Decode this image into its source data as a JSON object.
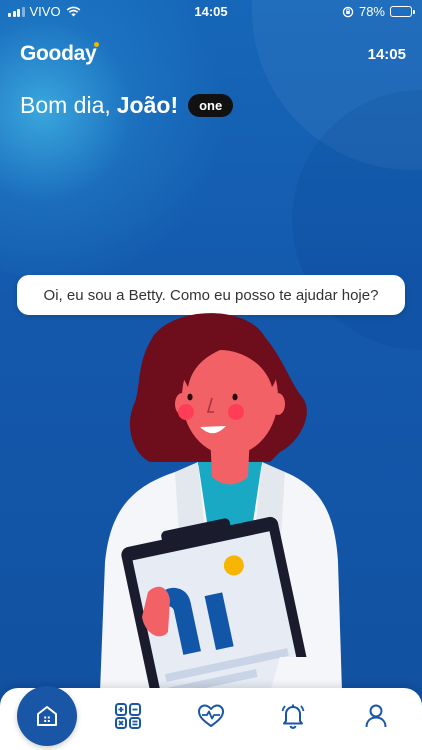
{
  "status_bar": {
    "carrier": "VIVO",
    "time": "14:05",
    "battery": "78%",
    "battery_level": 0.78
  },
  "header": {
    "logo": "Gooday",
    "clock": "14:05"
  },
  "greeting": {
    "prefix": "Bom dia,",
    "name": "João!",
    "badge": "one"
  },
  "assistant": {
    "message": "Oi, eu sou a Betty. Como eu posso te ajudar hoje?"
  },
  "nav": {
    "items": [
      {
        "icon": "home-icon",
        "active": true
      },
      {
        "icon": "calculator-icon",
        "active": false
      },
      {
        "icon": "heart-pulse-icon",
        "active": false
      },
      {
        "icon": "bell-icon",
        "active": false
      },
      {
        "icon": "user-icon",
        "active": false
      }
    ]
  },
  "colors": {
    "primary": "#1a56a6",
    "background": "#1459ad",
    "accent_yellow": "#f7b500"
  }
}
